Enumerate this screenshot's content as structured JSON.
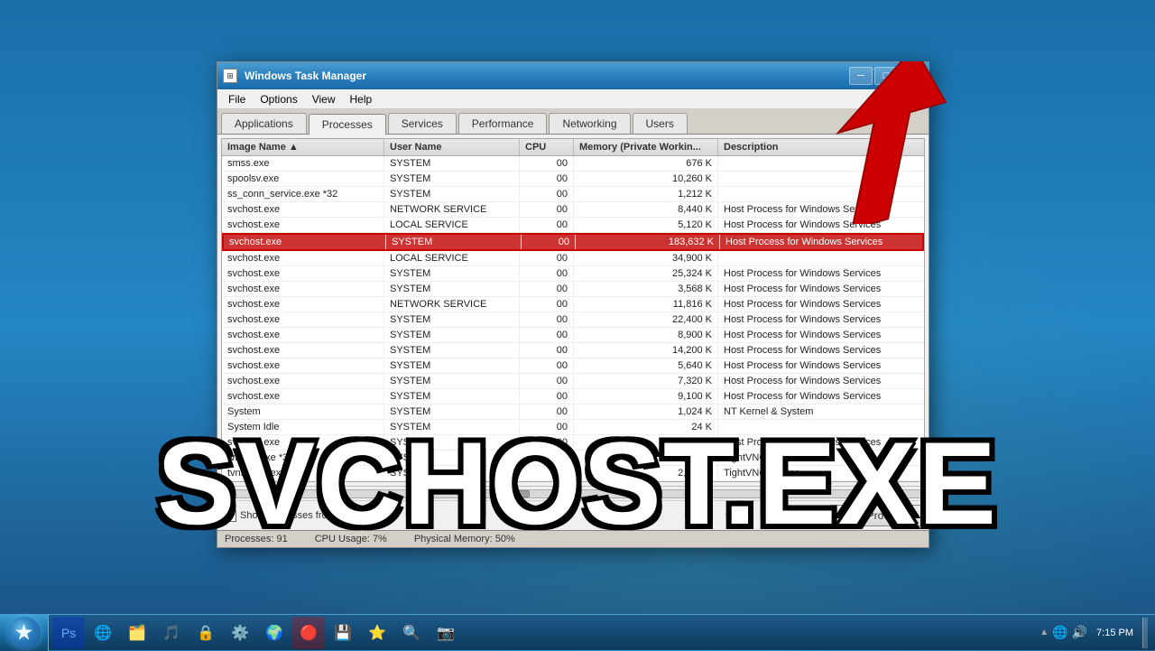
{
  "desktop": {
    "background": "Windows 7 desktop background"
  },
  "window": {
    "title": "Windows Task Manager",
    "icon": "TM",
    "controls": {
      "minimize": "─",
      "maximize": "□",
      "close": "✕"
    }
  },
  "menubar": {
    "items": [
      "File",
      "Options",
      "View",
      "Help"
    ]
  },
  "tabs": {
    "items": [
      "Applications",
      "Processes",
      "Services",
      "Performance",
      "Networking",
      "Users"
    ],
    "active": "Processes"
  },
  "table": {
    "columns": [
      "Image Name",
      "User Name",
      "CPU",
      "Memory (Private Workin...",
      "Description"
    ],
    "rows": [
      {
        "image": "smss.exe",
        "user": "SYSTEM",
        "cpu": "00",
        "memory": "676 K",
        "desc": ""
      },
      {
        "image": "spoolsv.exe",
        "user": "SYSTEM",
        "cpu": "00",
        "memory": "10,260 K",
        "desc": ""
      },
      {
        "image": "ss_conn_service.exe *32",
        "user": "SYSTEM",
        "cpu": "00",
        "memory": "1,212 K",
        "desc": ""
      },
      {
        "image": "svchost.exe",
        "user": "NETWORK SERVICE",
        "cpu": "00",
        "memory": "8,440 K",
        "desc": "Host Process for Windows Services"
      },
      {
        "image": "svchost.exe",
        "user": "LOCAL SERVICE",
        "cpu": "00",
        "memory": "5,120 K",
        "desc": "Host Process for Windows Services"
      },
      {
        "image": "svchost.exe",
        "user": "SYSTEM",
        "cpu": "00",
        "memory": "183,632 K",
        "desc": "Host Process for Windows Services",
        "selected": true
      },
      {
        "image": "svchost.exe",
        "user": "LOCAL SERVICE",
        "cpu": "00",
        "memory": "34,900 K",
        "desc": ""
      },
      {
        "image": "svchost.exe",
        "user": "SYSTEM",
        "cpu": "00",
        "memory": "25,324 K",
        "desc": "Host Process for Windows Services"
      },
      {
        "image": "svchost.exe",
        "user": "SYSTEM",
        "cpu": "00",
        "memory": "3,568 K",
        "desc": "Host Process for Windows Services"
      },
      {
        "image": "svchost.exe",
        "user": "NETWORK SERVICE",
        "cpu": "00",
        "memory": "11,816 K",
        "desc": "Host Process for Windows Services"
      },
      {
        "image": "svchost.exe",
        "user": "SYSTEM",
        "cpu": "00",
        "memory": "22,400 K",
        "desc": "Host Process for Windows Services"
      },
      {
        "image": "svchost.exe",
        "user": "SYSTEM",
        "cpu": "00",
        "memory": "8,900 K",
        "desc": "Host Process for Windows Services"
      },
      {
        "image": "svchost.exe",
        "user": "SYSTEM",
        "cpu": "00",
        "memory": "14,200 K",
        "desc": "Host Process for Windows Services"
      },
      {
        "image": "svchost.exe",
        "user": "SYSTEM",
        "cpu": "00",
        "memory": "5,640 K",
        "desc": "Host Process for Windows Services"
      },
      {
        "image": "svchost.exe",
        "user": "SYSTEM",
        "cpu": "00",
        "memory": "7,320 K",
        "desc": "Host Process for Windows Services"
      },
      {
        "image": "svchost.exe",
        "user": "SYSTEM",
        "cpu": "00",
        "memory": "9,100 K",
        "desc": "Host Process for Windows Services"
      },
      {
        "image": "System",
        "user": "SYSTEM",
        "cpu": "00",
        "memory": "1,024 K",
        "desc": "NT Kernel & System"
      },
      {
        "image": "System Idle",
        "user": "SYSTEM",
        "cpu": "00",
        "memory": "24 K",
        "desc": ""
      },
      {
        "image": "svchost.exe",
        "user": "SYSTEM",
        "cpu": "00",
        "memory": "4,200 K",
        "desc": "Host Process for Windows Services"
      },
      {
        "image": "tvnmgr.exe *32",
        "user": "SYSTEM",
        "cpu": "00",
        "memory": "2,164 K",
        "desc": "TightVNC Server"
      },
      {
        "image": "tvnserver.exe *32",
        "user": "SYSTEM",
        "cpu": "00",
        "memory": "2,164 K",
        "desc": "TightVNC Server"
      }
    ]
  },
  "footer": {
    "show_all_users_checkbox": true,
    "show_all_users_label": "Show processes from all users",
    "end_process_label": "End Process"
  },
  "statusbar": {
    "processes_label": "Processes:",
    "processes_count": "91",
    "cpu_label": "CPU Usage:",
    "cpu_value": "7%",
    "memory_label": "Physical Memory:",
    "memory_value": "50%"
  },
  "overlay": {
    "text": "SVCHOST.EXE"
  },
  "taskbar": {
    "time": "7:15 PM",
    "icons": [
      "🪟",
      "📷",
      "🗂️",
      "🌐",
      "⚙️",
      "🔒",
      "🔊",
      "🖥️",
      "🌍",
      "🔴",
      "💾",
      "🎵",
      "⭐"
    ]
  }
}
